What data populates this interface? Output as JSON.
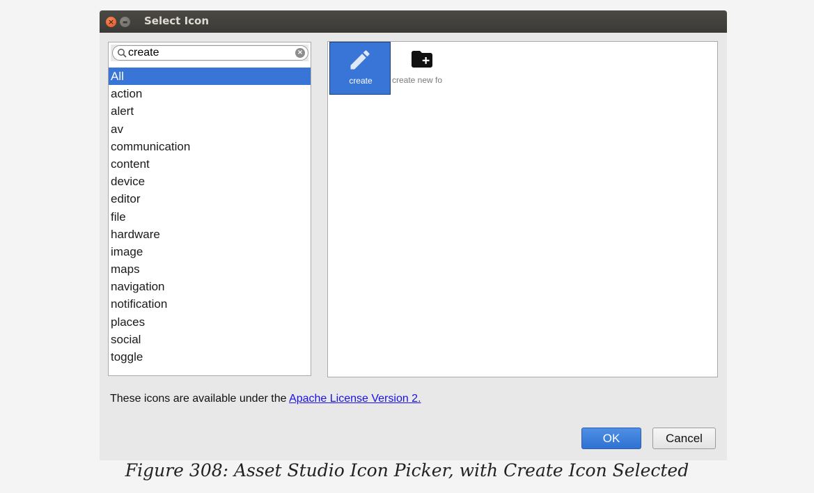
{
  "window": {
    "title": "Select Icon"
  },
  "search": {
    "value": "create"
  },
  "categories": [
    "All",
    "action",
    "alert",
    "av",
    "communication",
    "content",
    "device",
    "editor",
    "file",
    "hardware",
    "image",
    "maps",
    "navigation",
    "notification",
    "places",
    "social",
    "toggle"
  ],
  "selected_category": "All",
  "icons": [
    {
      "label": "create",
      "icon": "pencil-icon",
      "selected": true
    },
    {
      "label": "create new fo",
      "icon": "create-new-folder-icon",
      "selected": false
    }
  ],
  "license": {
    "prefix": "These icons are available under the ",
    "link_text": "Apache License Version 2."
  },
  "buttons": {
    "ok": "OK",
    "cancel": "Cancel"
  },
  "caption": "Figure 308: Asset Studio Icon Picker, with Create Icon Selected",
  "colors": {
    "accent": "#3875d6",
    "titlebar": "#3c3b37",
    "link": "#1a10e8"
  }
}
